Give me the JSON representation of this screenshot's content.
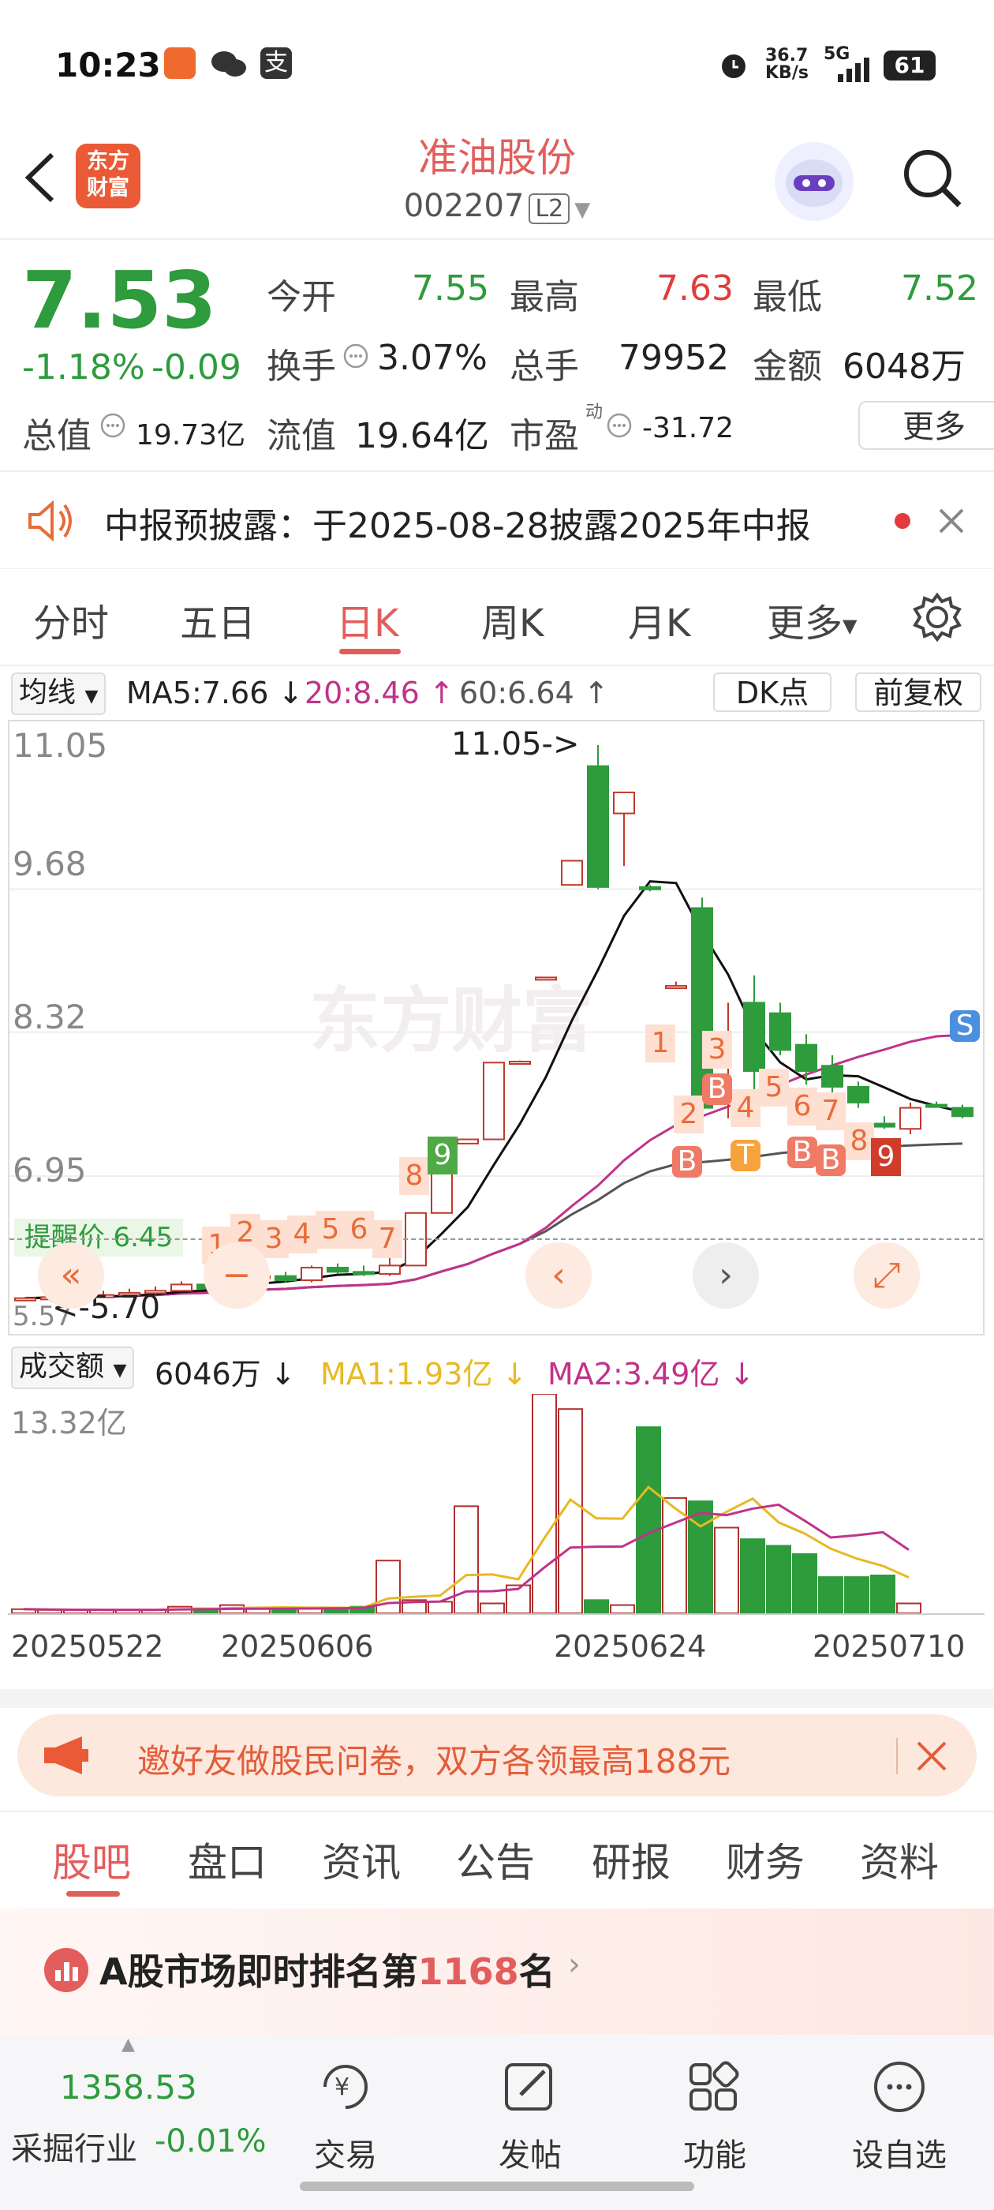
{
  "status_bar": {
    "time": "10:23",
    "net_speed_top": "36.7",
    "net_speed_bottom": "KB/s",
    "signal": "5G",
    "battery": "61"
  },
  "header": {
    "logo_line1": "东方",
    "logo_line2": "财富",
    "title": "准油股份",
    "code": "002207",
    "level": "L2"
  },
  "quote": {
    "price": "7.53",
    "change_pct": "-1.18%",
    "change": "-0.09",
    "open_label": "今开",
    "open": "7.55",
    "high_label": "最高",
    "high": "7.63",
    "low_label": "最低",
    "low": "7.52",
    "turnover_label": "换手",
    "turnover": "3.07%",
    "volume_label": "总手",
    "volume": "79952",
    "amount_label": "金额",
    "amount": "6048万",
    "mktcap_label": "总值",
    "mktcap": "19.73亿",
    "float_label": "流值",
    "float": "19.64亿",
    "pe_label": "市盈",
    "pe_sup": "动",
    "pe": "-31.72",
    "more": "更多"
  },
  "notice": {
    "text": "中报预披露：于2025-08-28披露2025年中报"
  },
  "tabs": [
    "分时",
    "五日",
    "日K",
    "周K",
    "月K",
    "更多"
  ],
  "chart_header": {
    "ma_select": "均线",
    "ma5": "MA5:7.66 ↓",
    "ma20": "20:8.46 ↑",
    "ma60": "60:6.64 ↑",
    "dk": "DK点",
    "adjust": "前复权"
  },
  "chart_data": {
    "type": "candlestick",
    "price_axis_labels": [
      "11.05",
      "9.68",
      "8.32",
      "6.95",
      "5.57"
    ],
    "max_label": "11.05->",
    "min_label": "<-5.70",
    "alert_price": "提醒价 6.45",
    "x_labels": [
      "20250522",
      "20250606",
      "20250624",
      "20250710"
    ],
    "volume_header": {
      "select": "成交额",
      "value": "6046万 ↓",
      "ma1": "MA1:1.93亿 ↓",
      "ma2": "MA2:3.49亿 ↓"
    },
    "volume_axis_label": "13.32亿",
    "candles": [
      [
        5.78,
        5.8,
        5.76,
        5.79
      ],
      [
        5.79,
        5.82,
        5.75,
        5.8
      ],
      [
        5.8,
        5.83,
        5.78,
        5.81
      ],
      [
        5.81,
        5.86,
        5.79,
        5.82
      ],
      [
        5.82,
        5.88,
        5.8,
        5.84
      ],
      [
        5.84,
        5.9,
        5.82,
        5.86
      ],
      [
        5.86,
        5.95,
        5.85,
        5.92
      ],
      [
        5.92,
        5.96,
        5.86,
        5.88
      ],
      [
        5.88,
        6.0,
        5.86,
        5.98
      ],
      [
        5.98,
        6.05,
        5.95,
        6.0
      ],
      [
        6.0,
        6.04,
        5.94,
        5.96
      ],
      [
        5.96,
        6.1,
        5.94,
        6.08
      ],
      [
        6.08,
        6.12,
        6.02,
        6.04
      ],
      [
        6.04,
        6.1,
        6.0,
        6.02
      ],
      [
        6.02,
        6.3,
        6.0,
        6.1
      ],
      [
        6.1,
        6.6,
        6.1,
        6.6
      ],
      [
        6.6,
        7.2,
        6.6,
        7.26
      ],
      [
        7.26,
        7.3,
        7.26,
        7.3
      ],
      [
        7.3,
        8.03,
        7.3,
        8.03
      ],
      [
        8.03,
        8.05,
        8.03,
        8.04
      ],
      [
        8.84,
        8.84,
        8.84,
        8.84
      ],
      [
        9.72,
        9.95,
        9.72,
        9.95
      ],
      [
        10.85,
        11.05,
        9.68,
        9.7
      ],
      [
        10.4,
        10.6,
        9.9,
        10.6
      ],
      [
        9.7,
        9.72,
        9.66,
        9.68
      ],
      [
        8.75,
        8.8,
        8.75,
        8.76
      ],
      [
        9.5,
        9.6,
        7.6,
        7.6
      ],
      [
        7.65,
        8.6,
        7.5,
        7.7
      ],
      [
        8.6,
        8.86,
        7.7,
        7.95
      ],
      [
        8.5,
        8.6,
        8.1,
        8.15
      ],
      [
        8.2,
        8.3,
        7.82,
        7.95
      ],
      [
        8.0,
        8.1,
        7.7,
        7.8
      ],
      [
        7.8,
        7.85,
        7.6,
        7.65
      ],
      [
        7.45,
        7.52,
        7.4,
        7.42
      ],
      [
        7.4,
        7.65,
        7.35,
        7.6
      ],
      [
        7.63,
        7.66,
        7.6,
        7.62
      ],
      [
        7.6,
        7.63,
        7.5,
        7.52
      ]
    ],
    "volumes": [
      0.25,
      0.2,
      0.2,
      0.2,
      0.2,
      0.2,
      0.4,
      0.3,
      0.5,
      0.3,
      0.3,
      0.3,
      0.3,
      0.4,
      3.2,
      0.8,
      0.7,
      6.5,
      0.6,
      1.7,
      13.32,
      12.4,
      0.8,
      0.5,
      11.3,
      7.0,
      6.8,
      5.2,
      4.5,
      4.1,
      3.6,
      2.2,
      2.2,
      2.3,
      0.6
    ]
  },
  "chart_markers": {
    "numbers_a": [
      "1",
      "2",
      "3",
      "4",
      "5",
      "6",
      "7"
    ],
    "numbers_b": [
      "8",
      "9"
    ],
    "numbers_c": [
      "1",
      "2",
      "3",
      "4",
      "5",
      "6",
      "7",
      "8",
      "9"
    ],
    "letters": [
      "B",
      "B",
      "T",
      "B",
      "B",
      "S"
    ]
  },
  "promo": {
    "text": "邀好友做股民问卷，双方各领最高188元"
  },
  "bottom_tabs": [
    "股吧",
    "盘口",
    "资讯",
    "公告",
    "研报",
    "财务",
    "资料"
  ],
  "ranking": {
    "prefix": "A股市场即时排名第",
    "rank": "1168",
    "suffix": "名"
  },
  "bottom_nav": {
    "index_value": "1358.53",
    "index_name": "采掘行业",
    "index_change": "-0.01%",
    "items": [
      "交易",
      "发帖",
      "功能",
      "设自选"
    ]
  },
  "colors": {
    "up": "#e33b3b",
    "down": "#2e9b3d",
    "accent": "#e35d5d",
    "ma5": "#111111",
    "ma20": "#c0338a",
    "ma60": "#555555"
  }
}
